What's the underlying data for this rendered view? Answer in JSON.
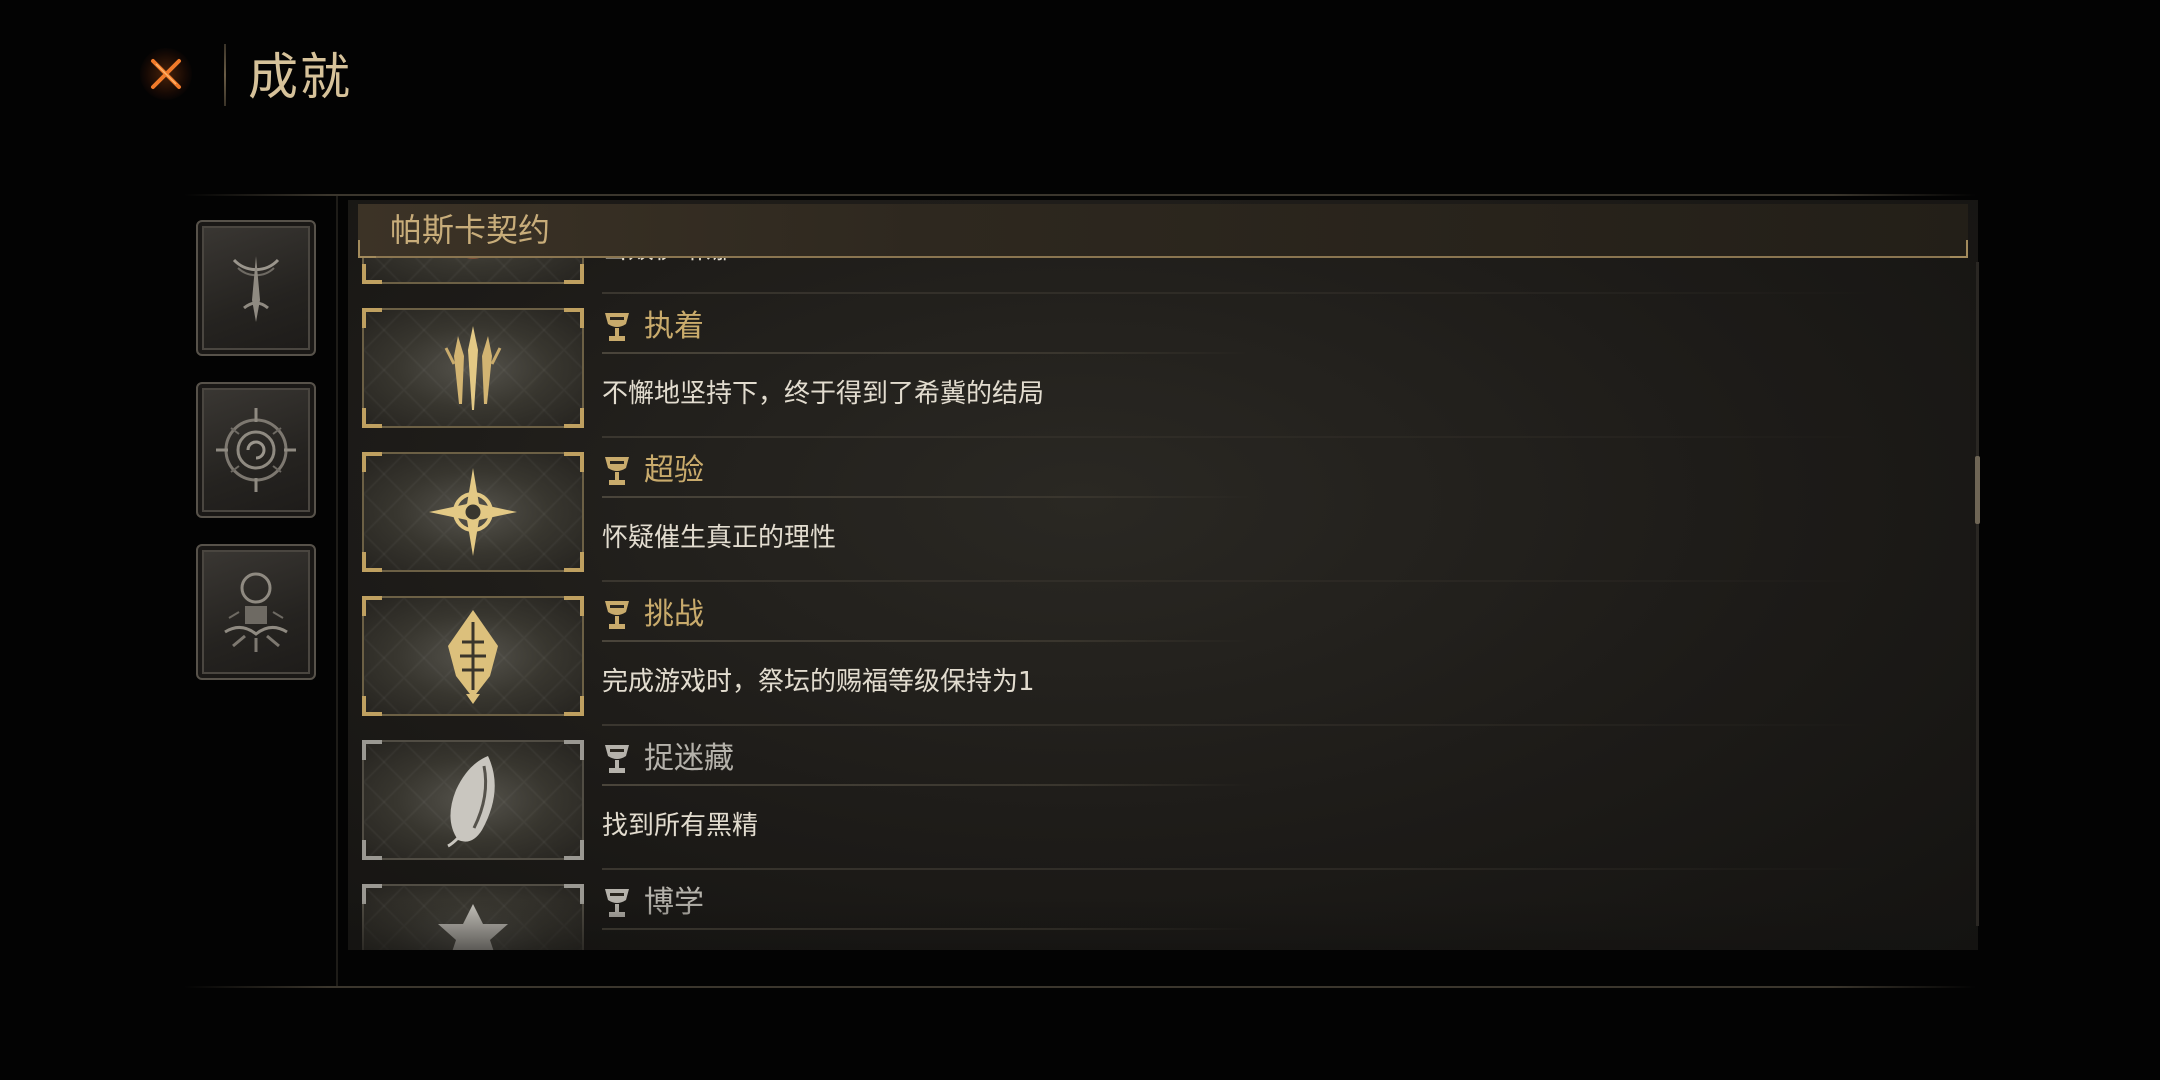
{
  "header": {
    "title": "成就",
    "close_icon": "close-x-icon"
  },
  "categories": [
    {
      "icon": "crescent-spire-icon",
      "state": "normal"
    },
    {
      "icon": "spiral-compass-icon",
      "state": "normal"
    },
    {
      "icon": "ritual-altar-icon",
      "state": "normal"
    }
  ],
  "section": {
    "title": "帕斯卡契约"
  },
  "achievements": [
    {
      "title": "",
      "description": "击败伊琳娜",
      "tier": "gold",
      "icon": "boss-portrait-icon",
      "partial": "top"
    },
    {
      "title": "执着",
      "description": "不懈地坚持下，终于得到了希冀的结局",
      "tier": "gold",
      "icon": "claw-sigil-icon"
    },
    {
      "title": "超验",
      "description": "怀疑催生真正的理性",
      "tier": "gold",
      "icon": "compass-star-icon"
    },
    {
      "title": "挑战",
      "description": "完成游戏时，祭坛的赐福等级保持为1",
      "tier": "gold",
      "icon": "flame-relic-icon"
    },
    {
      "title": "捉迷藏",
      "description": "找到所有黑精",
      "tier": "silver",
      "icon": "shell-leaf-icon"
    },
    {
      "title": "博学",
      "description": "",
      "tier": "silver",
      "icon": "crown-tome-icon",
      "partial": "bottom"
    }
  ],
  "colors": {
    "gold": "#c9ab6c",
    "silver": "#b5b2ab",
    "accent_close": "#e0641c"
  }
}
